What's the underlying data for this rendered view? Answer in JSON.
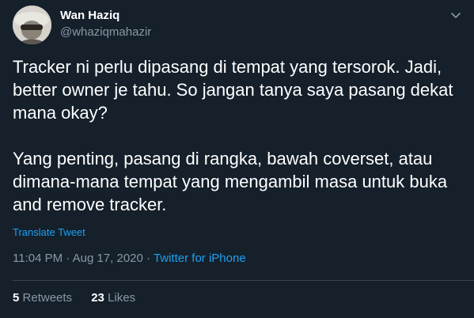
{
  "author": {
    "display_name": "Wan Haziq",
    "handle": "@whaziqmahazir",
    "avatar_icon": "user-avatar"
  },
  "tweet": {
    "text": "Tracker ni perlu dipasang di tempat yang tersorok. Jadi, better owner je tahu. So jangan tanya saya pasang dekat mana okay?\n\nYang penting, pasang di rangka, bawah coverset, atau dimana-mana tempat yang mengambil masa untuk buka and remove tracker.",
    "translate_label": "Translate Tweet",
    "time": "11:04 PM",
    "separator": "·",
    "date": "Aug 17, 2020",
    "source": "Twitter for iPhone"
  },
  "stats": {
    "retweets_count": "5",
    "retweets_label": "Retweets",
    "likes_count": "23",
    "likes_label": "Likes"
  },
  "menu": {
    "icon": "chevron-down-icon"
  },
  "colors": {
    "background": "#15202b",
    "text_primary": "#ffffff",
    "text_secondary": "#8899a6",
    "accent": "#1da1f2",
    "divider": "#38444d"
  }
}
